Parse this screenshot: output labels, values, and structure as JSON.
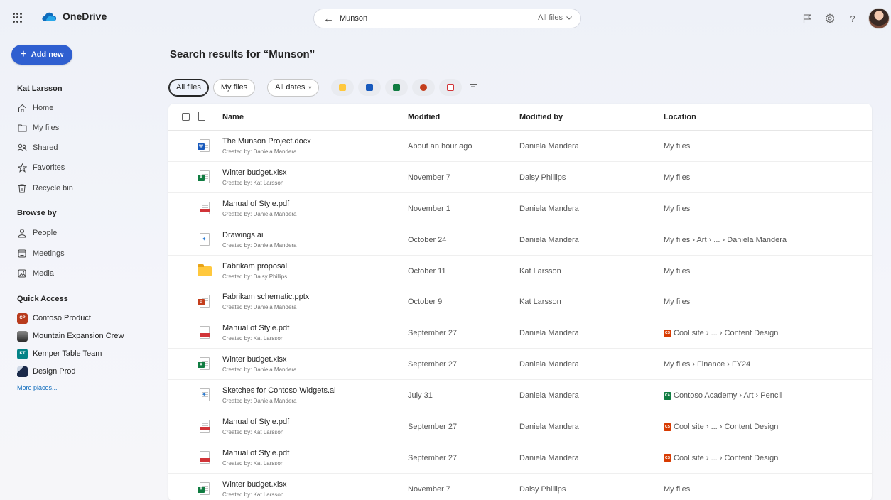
{
  "app": {
    "name": "OneDrive"
  },
  "colors": {
    "accent": "#2f5fd0",
    "word": "#185abd",
    "excel": "#107c41",
    "pdf": "#d13438",
    "powerpoint": "#c43e1c",
    "folder": "#ffc83d"
  },
  "search": {
    "query": "Munson",
    "scope": "All files",
    "back_icon": "arrow-left-icon",
    "scope_icon": "chevron-down-icon"
  },
  "topbar_icons": [
    "flag-icon",
    "settings-icon",
    "help-icon",
    "profile-avatar"
  ],
  "sidebar": {
    "add_new_label": "Add new",
    "user_name": "Kat Larsson",
    "nav": [
      {
        "label": "Home",
        "icon": "home-icon"
      },
      {
        "label": "My files",
        "icon": "folder-icon"
      },
      {
        "label": "Shared",
        "icon": "people-icon"
      },
      {
        "label": "Favorites",
        "icon": "star-icon"
      },
      {
        "label": "Recycle bin",
        "icon": "trash-icon"
      }
    ],
    "browse_heading": "Browse by",
    "browse": [
      {
        "label": "People",
        "icon": "person-icon"
      },
      {
        "label": "Meetings",
        "icon": "calendar-icon"
      },
      {
        "label": "Media",
        "icon": "image-icon"
      }
    ],
    "quick_access_heading": "Quick Access",
    "quick_access": [
      {
        "label": "Contoso Product",
        "badge": "CP",
        "color": "#b83b1d"
      },
      {
        "label": "Mountain Expansion Crew",
        "badge": "",
        "color": "#3b3b3b"
      },
      {
        "label": "Kemper Table Team",
        "badge": "KT",
        "color": "#038387"
      },
      {
        "label": "Design Prod",
        "badge": "",
        "color": "#1b2a4a"
      }
    ],
    "more_places": "More places..."
  },
  "main": {
    "title": "Search results for “Munson”",
    "filters": {
      "all_files": "All files",
      "my_files": "My files",
      "all_dates": "All dates"
    },
    "type_filters": [
      "folder",
      "word",
      "excel",
      "powerpoint",
      "pdf"
    ],
    "columns": {
      "name": "Name",
      "modified": "Modified",
      "modified_by": "Modified by",
      "location": "Location"
    },
    "rows": [
      {
        "type": "word",
        "name": "The Munson Project.docx",
        "created": "Created by: Daniela Mandera",
        "modified": "About an hour ago",
        "modified_by": "Daniela Mandera",
        "location": "My files",
        "loc_badge": "",
        "loc_color": ""
      },
      {
        "type": "excel",
        "name": "Winter budget.xlsx",
        "created": "Created by: Kat Larsson",
        "modified": "November 7",
        "modified_by": "Daisy Phillips",
        "location": "My files",
        "loc_badge": "",
        "loc_color": ""
      },
      {
        "type": "pdf",
        "name": "Manual of Style.pdf",
        "created": "Created by: Daniela Mandera",
        "modified": "November 1",
        "modified_by": "Daniela Mandera",
        "location": "My files",
        "loc_badge": "",
        "loc_color": ""
      },
      {
        "type": "ai",
        "name": "Drawings.ai",
        "created": "Created by: Daniela Mandera",
        "modified": "October 24",
        "modified_by": "Daniela Mandera",
        "location": "My files › Art › ... › Daniela Mandera",
        "loc_badge": "",
        "loc_color": ""
      },
      {
        "type": "folder",
        "name": "Fabrikam proposal",
        "created": "Created by: Daisy Phillips",
        "modified": "October 11",
        "modified_by": "Kat Larsson",
        "location": "My files",
        "loc_badge": "",
        "loc_color": ""
      },
      {
        "type": "powerpoint",
        "name": "Fabrikam schematic.pptx",
        "created": "Created by: Daniela Mandera",
        "modified": "October 9",
        "modified_by": "Kat Larsson",
        "location": "My files",
        "loc_badge": "",
        "loc_color": ""
      },
      {
        "type": "pdf",
        "name": "Manual of Style.pdf",
        "created": "Created by: Kat Larsson",
        "modified": "September 27",
        "modified_by": "Daniela Mandera",
        "location": "Cool site › ... › Content Design",
        "loc_badge": "CS",
        "loc_color": "#d83b01"
      },
      {
        "type": "excel",
        "name": "Winter budget.xlsx",
        "created": "Created by: Daniela Mandera",
        "modified": "September 27",
        "modified_by": "Daniela Mandera",
        "location": "My files › Finance › FY24",
        "loc_badge": "",
        "loc_color": ""
      },
      {
        "type": "ai",
        "name": "Sketches for Contoso Widgets.ai",
        "created": "Created by: Daniela Mandera",
        "modified": "July 31",
        "modified_by": "Daniela Mandera",
        "location": "Contoso Academy › Art › Pencil",
        "loc_badge": "CA",
        "loc_color": "#107c41"
      },
      {
        "type": "pdf",
        "name": "Manual of Style.pdf",
        "created": "Created by: Kat Larsson",
        "modified": "September 27",
        "modified_by": "Daniela Mandera",
        "location": "Cool site › ... › Content Design",
        "loc_badge": "CS",
        "loc_color": "#d83b01"
      },
      {
        "type": "pdf",
        "name": "Manual of Style.pdf",
        "created": "Created by: Kat Larsson",
        "modified": "September 27",
        "modified_by": "Daniela Mandera",
        "location": "Cool site › ... › Content Design",
        "loc_badge": "CS",
        "loc_color": "#d83b01"
      },
      {
        "type": "excel",
        "name": "Winter budget.xlsx",
        "created": "Created by: Kat Larsson",
        "modified": "November 7",
        "modified_by": "Daisy Phillips",
        "location": "My files",
        "loc_badge": "",
        "loc_color": ""
      }
    ]
  }
}
